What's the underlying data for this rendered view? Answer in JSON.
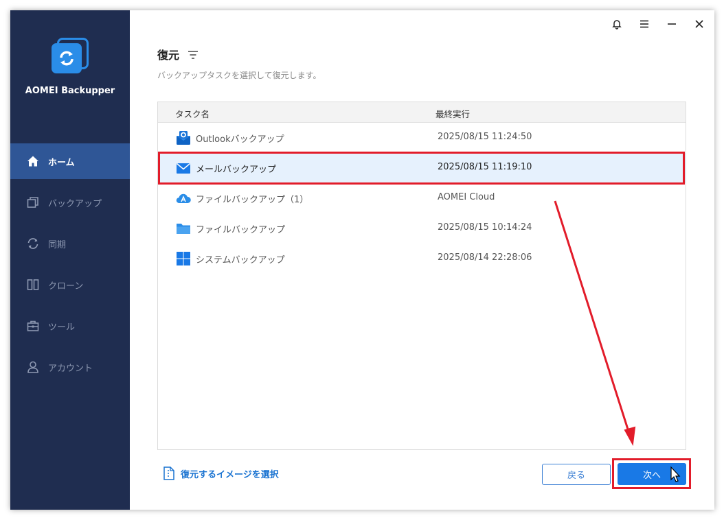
{
  "app": {
    "name": "AOMEI Backupper"
  },
  "sidebar": {
    "items": [
      {
        "label": "ホーム",
        "icon": "home-icon",
        "active": true
      },
      {
        "label": "バックアップ",
        "icon": "backup-icon",
        "active": false
      },
      {
        "label": "同期",
        "icon": "sync-icon",
        "active": false
      },
      {
        "label": "クローン",
        "icon": "clone-icon",
        "active": false
      },
      {
        "label": "ツール",
        "icon": "toolbox-icon",
        "active": false
      },
      {
        "label": "アカウント",
        "icon": "user-icon",
        "active": false
      }
    ]
  },
  "topbar": {
    "icons": [
      "bell-icon",
      "menu-icon",
      "minimize-icon",
      "close-icon"
    ]
  },
  "main": {
    "title": "復元",
    "subtitle": "バックアップタスクを選択して復元します。",
    "table": {
      "columns": [
        "タスク名",
        "最終実行"
      ],
      "rows": [
        {
          "name": "Outlookバックアップ",
          "time": "2025/08/15 11:24:50",
          "icon": "outlook-icon",
          "selected": false
        },
        {
          "name": "メールバックアップ",
          "time": "2025/08/15 11:19:10",
          "icon": "mail-icon",
          "selected": true
        },
        {
          "name": "ファイルバックアップ（1）",
          "time": "AOMEI Cloud",
          "icon": "cloud-icon",
          "selected": false
        },
        {
          "name": "ファイルバックアップ",
          "time": "2025/08/15 10:14:24",
          "icon": "folder-icon",
          "selected": false
        },
        {
          "name": "システムバックアップ",
          "time": "2025/08/14 22:28:06",
          "icon": "windows-icon",
          "selected": false
        }
      ]
    },
    "select_image_label": "復元するイメージを選択",
    "back_label": "戻る",
    "next_label": "次へ"
  },
  "colors": {
    "sidebar": "#1f2d50",
    "active": "#2f5696",
    "accent": "#1979e6",
    "highlight": "#e21c2a"
  }
}
